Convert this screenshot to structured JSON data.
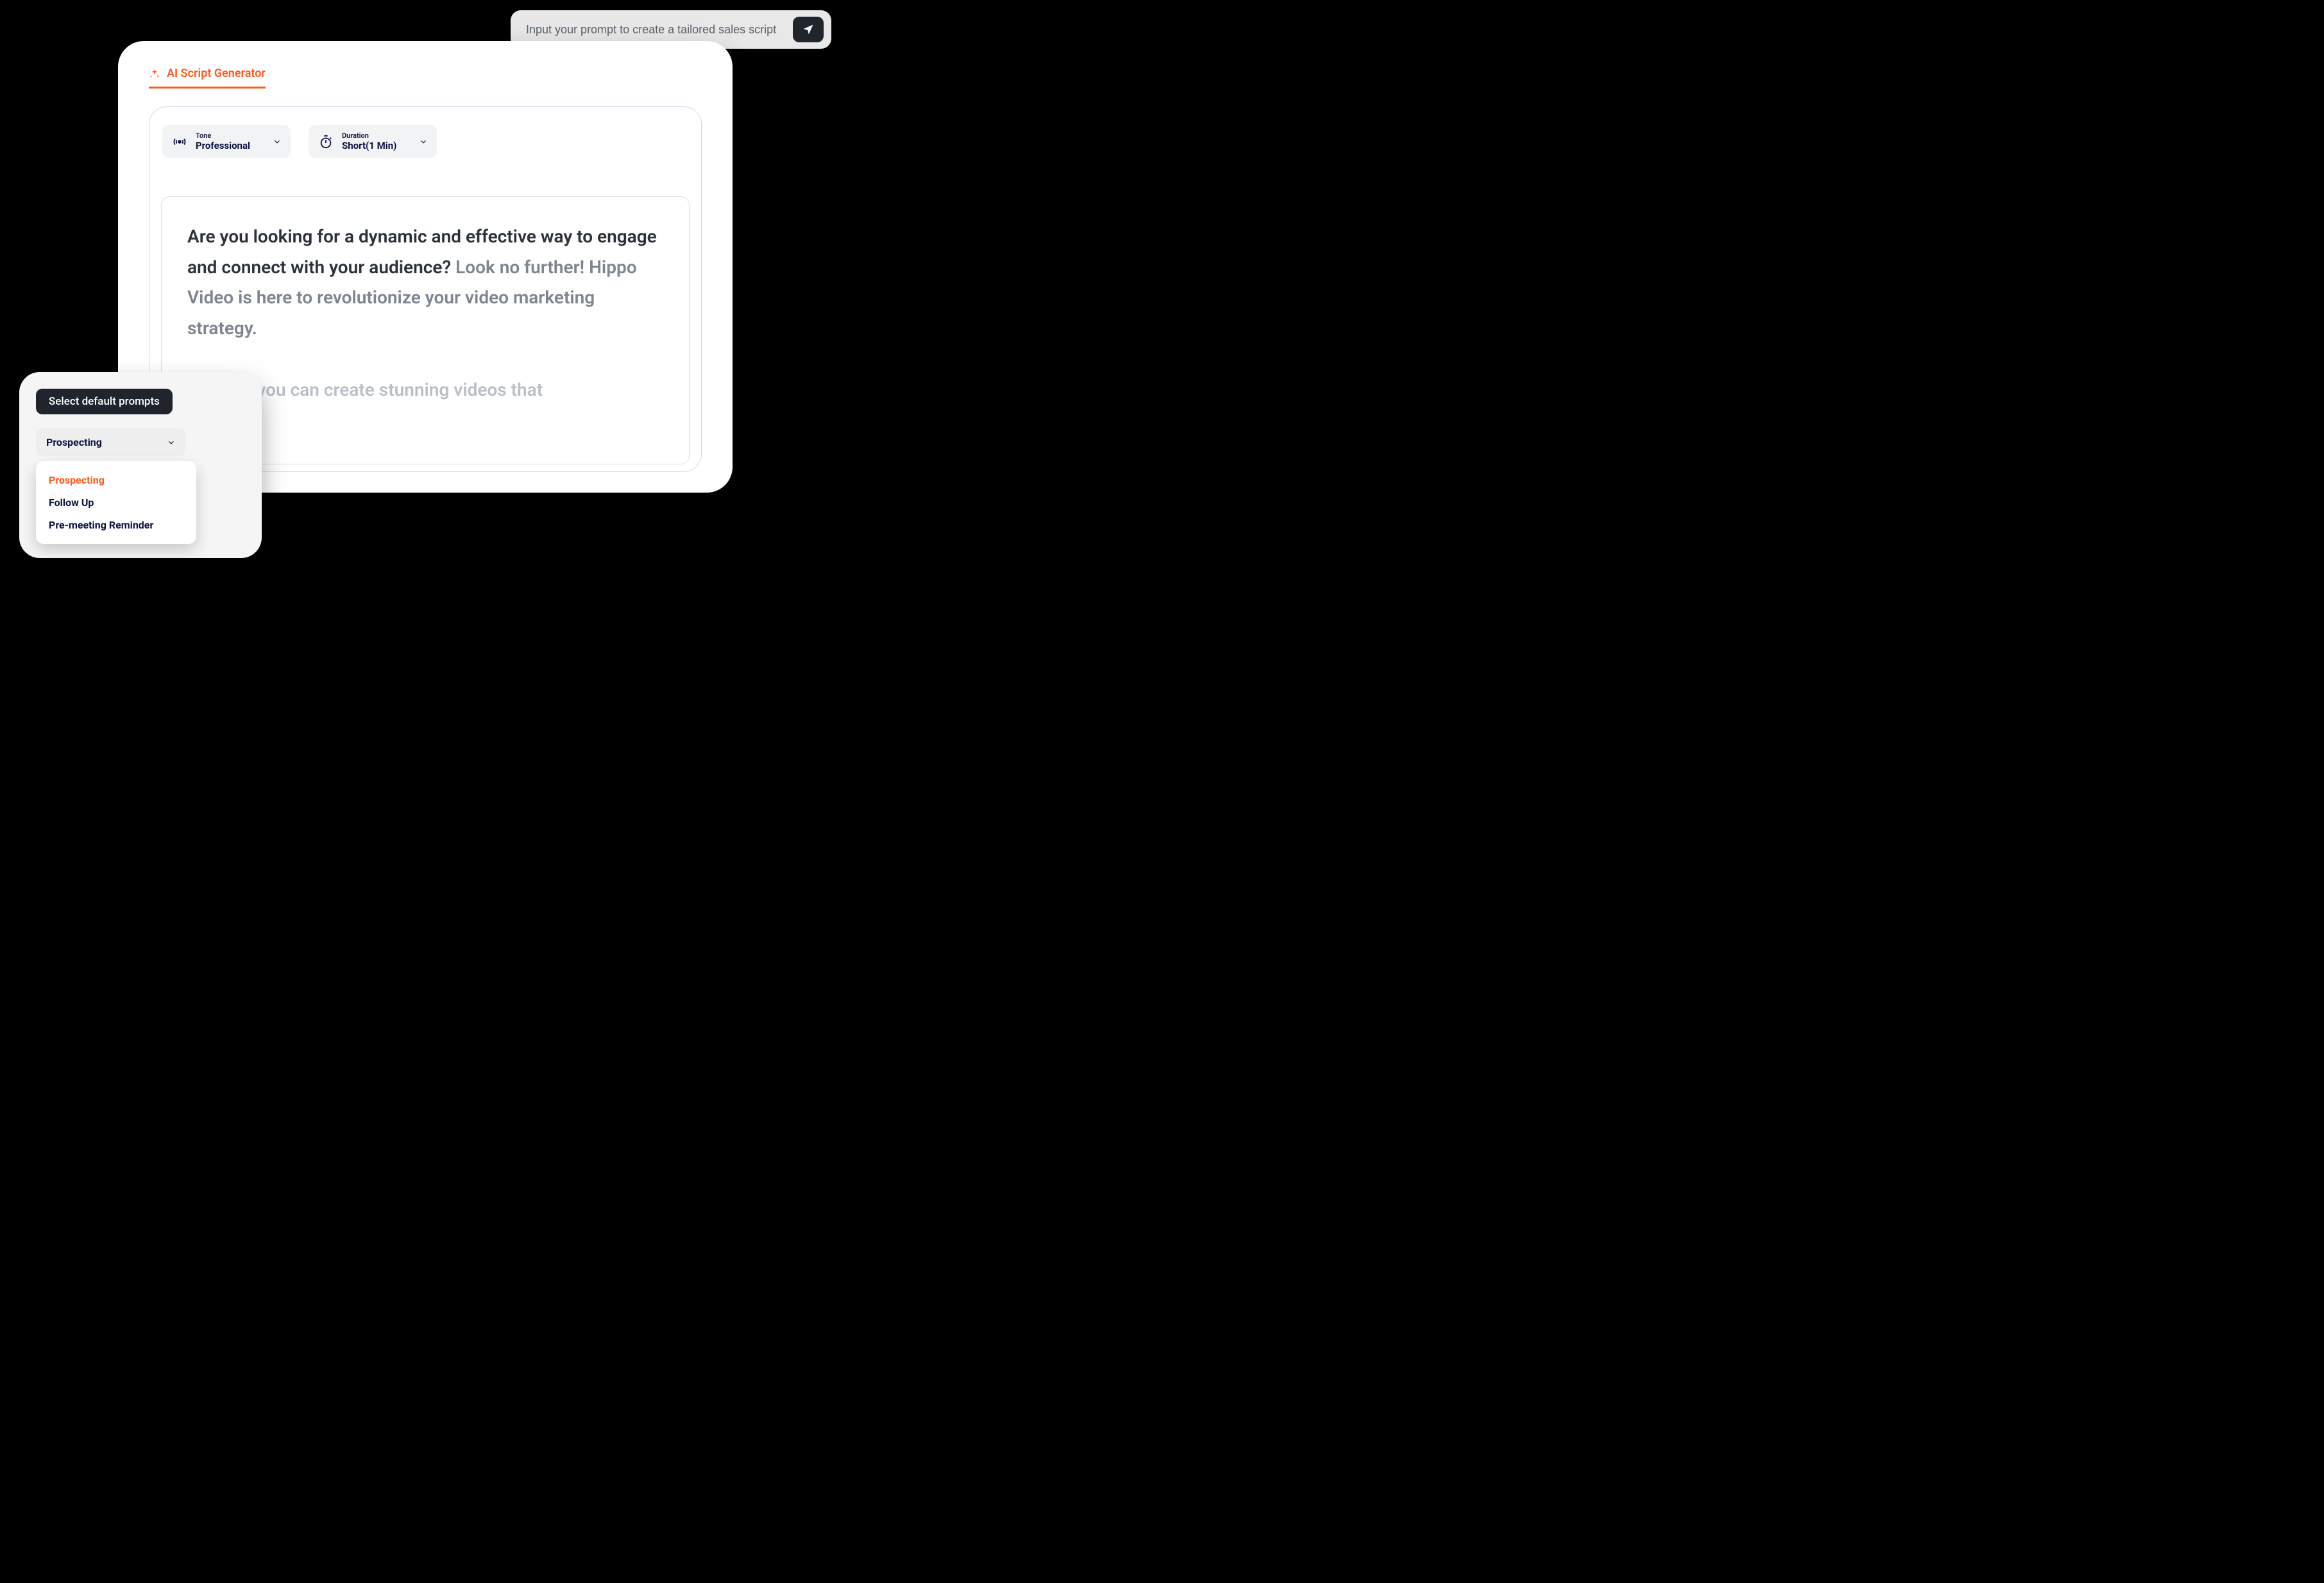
{
  "prompt_bar": {
    "placeholder": "Input your prompt to create a tailored sales script"
  },
  "tab": {
    "label": "AI Script  Generator"
  },
  "selectors": {
    "tone": {
      "label": "Tone",
      "value": "Professional"
    },
    "duration": {
      "label": "Duration",
      "value": "Short(1 Min)"
    }
  },
  "script": {
    "lead": "Are you looking for a dynamic and effective way to engage and connect with your audience?",
    "rest": " Look no further! Hippo Video is here to revolutionize your video marketing strategy.",
    "p2": "o Video, you can create stunning videos that"
  },
  "defaults": {
    "title": "Select default prompts",
    "selected": "Prospecting",
    "options": [
      "Prospecting",
      "Follow Up",
      "Pre-meeting Reminder"
    ]
  }
}
